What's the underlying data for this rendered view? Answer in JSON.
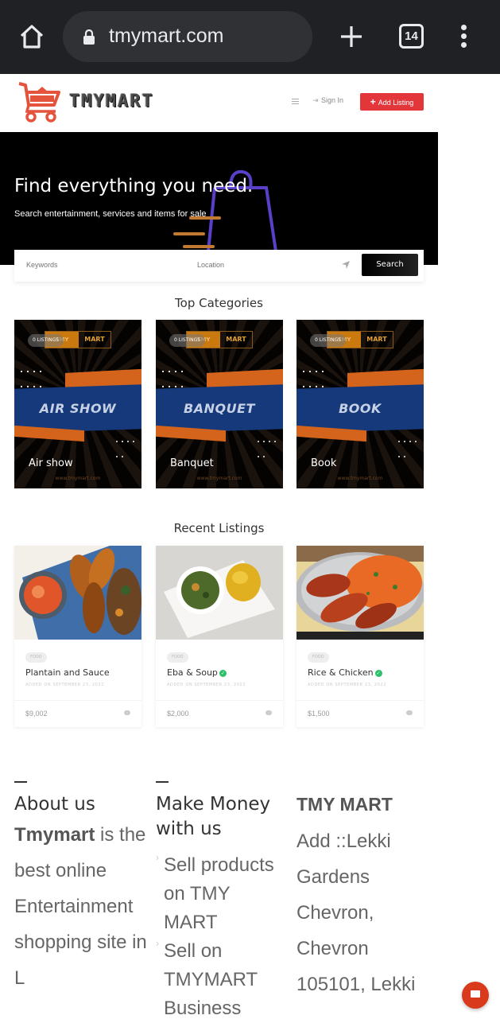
{
  "browser": {
    "url": "tmymart.com",
    "tab_count": "14"
  },
  "header": {
    "logo_text": "TMYMART",
    "signin_label": "Sign In",
    "add_listing_label": "Add Listing",
    "brand_color": "#e2363b"
  },
  "hero": {
    "title": "Find everything you need.",
    "subtitle": "Search entertainment, services and items for sale"
  },
  "search": {
    "keywords_placeholder": "Keywords",
    "location_placeholder": "Location",
    "button_label": "Search"
  },
  "top_categories": {
    "title": "Top Categories",
    "items": [
      {
        "name": "Air show",
        "banner": "AIR SHOW",
        "count": "0 LISTINGS",
        "logo_left": "TMY",
        "logo_right": "MART",
        "site": "www.tmymart.com"
      },
      {
        "name": "Banquet",
        "banner": "BANQUET",
        "count": "0 LISTINGS",
        "logo_left": "TMY",
        "logo_right": "MART",
        "site": "www.tmymart.com"
      },
      {
        "name": "Book",
        "banner": "BOOK",
        "count": "0 LISTINGS",
        "logo_left": "TMY",
        "logo_right": "MART",
        "site": "www.tmymart.com"
      }
    ]
  },
  "recent_listings": {
    "title": "Recent Listings",
    "items": [
      {
        "tag": "FOOD",
        "title": "Plantain and Sauce",
        "verified": false,
        "date": "ADDED ON SEPTEMBER 23, 2022",
        "price": "$9,002"
      },
      {
        "tag": "FOOD",
        "title": "Eba & Soup",
        "verified": true,
        "date": "ADDED ON SEPTEMBER 23, 2022",
        "price": "$2,000"
      },
      {
        "tag": "FOOD",
        "title": "Rice & Chicken",
        "verified": true,
        "date": "ADDED ON SEPTEMBER 23, 2022",
        "price": "$1,500"
      }
    ]
  },
  "footer": {
    "about": {
      "title": "About us",
      "brand": "Tmymart",
      "text": " is the best online Entertainment shopping site in L"
    },
    "make_money": {
      "title": "Make Money with us",
      "links": [
        "Sell products on TMY MART",
        "Sell on TMYMART Business"
      ]
    },
    "contact": {
      "title": "TMY MART",
      "address": "Add ::Lekki Gardens Chevron, Chevron 105101, Lekki"
    }
  }
}
